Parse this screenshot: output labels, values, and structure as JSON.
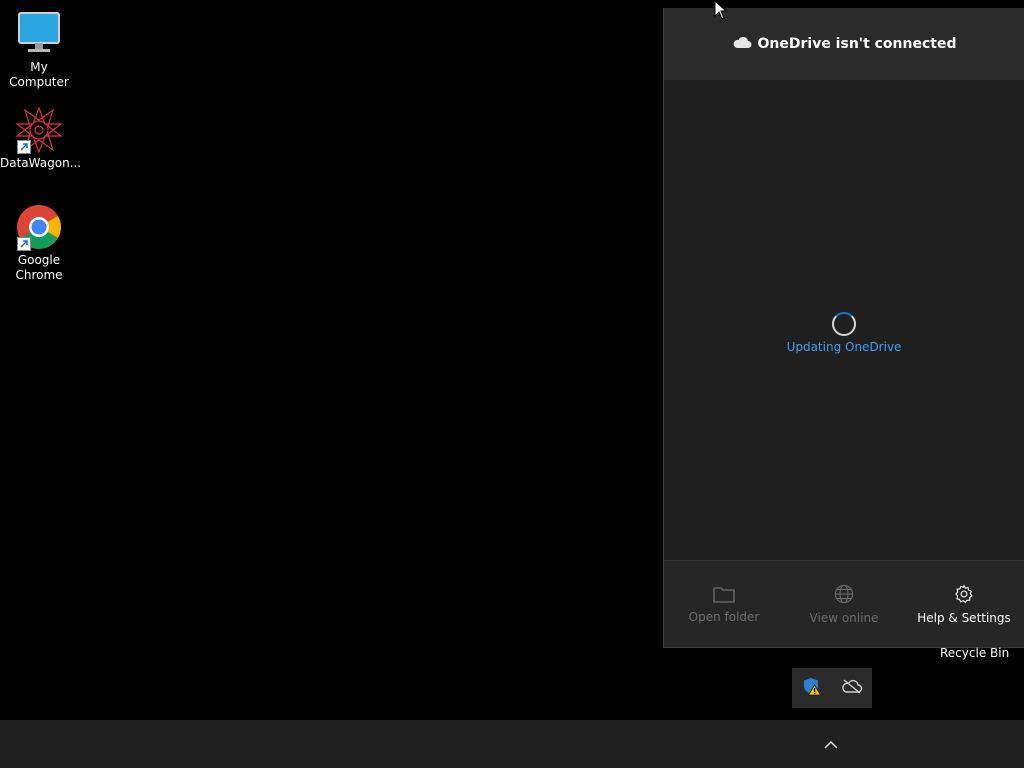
{
  "desktop": {
    "icons": [
      {
        "label": "My Computer",
        "icon": "monitor-icon"
      },
      {
        "label": "DataWagon...",
        "icon": "datawagon-icon"
      },
      {
        "label": "Google Chrome",
        "icon": "chrome-icon"
      }
    ],
    "recycle_bin_label": "Recycle Bin"
  },
  "onedrive": {
    "title": "OneDrive isn't connected",
    "status": "Updating OneDrive",
    "actions": [
      {
        "label": "Open folder",
        "icon": "folder-icon",
        "enabled": false
      },
      {
        "label": "View online",
        "icon": "globe-icon",
        "enabled": false
      },
      {
        "label": "Help & Settings",
        "icon": "gear-icon",
        "enabled": true
      }
    ]
  },
  "tray": {
    "overflow_icons": [
      "defender-warning-icon",
      "onedrive-offline-icon"
    ],
    "chevron": "chevron-up-icon"
  },
  "colors": {
    "accent": "#3aa0f3",
    "panel_bg": "#1f1f1f",
    "taskbar_bg": "#202020"
  }
}
